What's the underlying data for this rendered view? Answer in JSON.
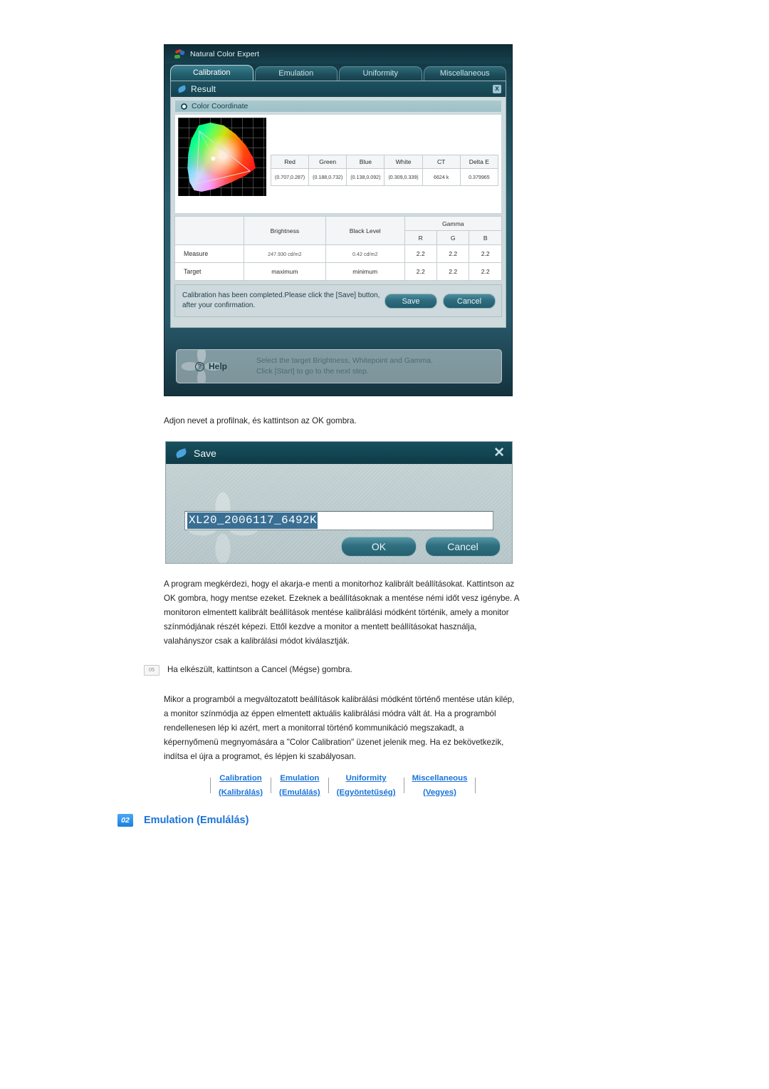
{
  "nce_window": {
    "app_title": "Natural Color Expert",
    "tabs": [
      {
        "label": "Calibration",
        "active": true
      },
      {
        "label": "Emulation",
        "active": false
      },
      {
        "label": "Uniformity",
        "active": false
      },
      {
        "label": "Miscellaneous",
        "active": false
      }
    ],
    "result_panel": {
      "title": "Result",
      "close_label": "x",
      "section_label": "Color Coordinate",
      "coordinate_table": {
        "headers": [
          "Red",
          "Green",
          "Blue",
          "White",
          "CT",
          "Delta E"
        ],
        "values": [
          "(0.707,0.287)",
          "(0.188,0.732)",
          "(0.138,0.092)",
          "(0.309,0.339)",
          "6624 k",
          "0.379965"
        ]
      },
      "measure_table": {
        "col_blank": "",
        "col_brightness": "Brightness",
        "col_blacklevel": "Black Level",
        "col_gamma": "Gamma",
        "gamma_sub": [
          "R",
          "G",
          "B"
        ],
        "rows": [
          {
            "name": "Measure",
            "brightness": "247.930 cd/m2",
            "black_level": "0.42 cd/m2",
            "gamma_r": "2.2",
            "gamma_g": "2.2",
            "gamma_b": "2.2"
          },
          {
            "name": "Target",
            "brightness": "maximum",
            "black_level": "minimum",
            "gamma_r": "2.2",
            "gamma_g": "2.2",
            "gamma_b": "2.2"
          }
        ]
      },
      "message": "Calibration has been completed.Please click the [Save] button, after your confirmation.",
      "save_button": "Save",
      "cancel_button": "Cancel"
    },
    "help": {
      "label": "Help",
      "line1": "Select the target Brightness, Whitepoint and Gamma.",
      "line2": "Click [Start] to go to the next step."
    }
  },
  "save_dialog": {
    "title": "Save",
    "close_label": "✕",
    "input_value": "XL20_2006117_6492K",
    "ok_button": "OK",
    "cancel_button": "Cancel"
  },
  "body": {
    "intro": "Adjon nevet a profilnak, és kattintson az OK gombra.",
    "block1": "A program megkérdezi, hogy el akarja-e menti a monitorhoz kalibrált beállításokat. Kattintson az OK gombra, hogy mentse ezeket. Ezeknek a beállításoknak a mentése némi időt vesz igénybe. A monitoron elmentett kalibrált beállítások mentése kalibrálási módként történik, amely a monitor színmódjának részét képezi. Ettől kezdve a monitor a mentett beállításokat használja, valahányszor csak a kalibrálási módot kiválasztják.",
    "step_number": "05",
    "step_text": "Ha elkészült, kattintson a Cancel (Mégse) gombra.",
    "block2": "Mikor a programból a megváltozatott beállítások kalibrálási módként történő mentése után kilép, a monitor színmódja az éppen elmentett aktuális kalibrálási módra vált át. Ha a programból rendellenesen lép ki azért, mert a monitorral történő kommunikáció megszakadt, a képernyőmenü megnyomására a \"Color Calibration\" üzenet jelenik meg. Ha ez bekövetkezik, indítsa el újra a programot, és lépjen ki szabályosan."
  },
  "nav_links": [
    {
      "en": "Calibration",
      "hu": "(Kalibrálás)"
    },
    {
      "en": "Emulation",
      "hu": "(Emulálás)"
    },
    {
      "en": "Uniformity",
      "hu": "(Egyöntetűség)"
    },
    {
      "en": "Miscellaneous",
      "hu": "(Vegyes)"
    }
  ],
  "section": {
    "badge": "02",
    "title": "Emulation (Emulálás)"
  },
  "colors": {
    "link_blue": "#1a73d8",
    "badge_blue": "#1b7fe0",
    "window_teal": "#1d4f5c",
    "dialog_gray": "#b9c9cc"
  }
}
